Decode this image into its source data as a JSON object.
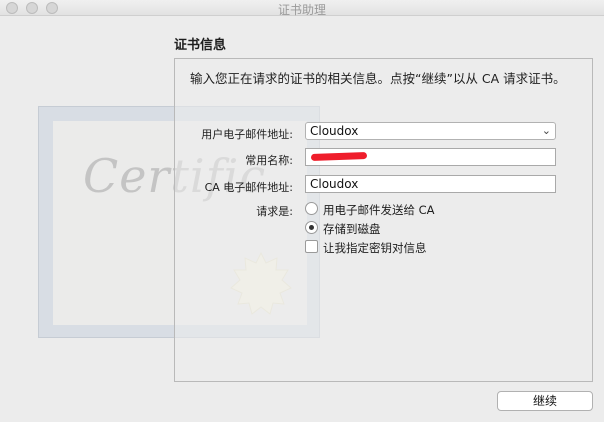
{
  "window": {
    "title": "证书助理"
  },
  "section": {
    "heading": "证书信息"
  },
  "info_text": "输入您正在请求的证书的相关信息。点按“继续”以从 CA 请求证书。",
  "artwork": {
    "script_text": "Certific"
  },
  "form": {
    "user_email_label": "用户电子邮件地址:",
    "user_email_value": "Cloudox",
    "common_name_label": "常用名称:",
    "common_name_value": "",
    "ca_email_label": "CA 电子邮件地址:",
    "ca_email_value": "Cloudox",
    "request_label": "请求是:",
    "options": {
      "email_to_ca": "用电子邮件发送给 CA",
      "save_to_disk": "存储到磁盘",
      "specify_key_pair": "让我指定密钥对信息"
    },
    "selected_option": "存储到磁盘",
    "specify_key_pair_checked": false
  },
  "buttons": {
    "continue": "继续"
  },
  "icons": {
    "select_chevron": "chevron-updown-icon"
  }
}
